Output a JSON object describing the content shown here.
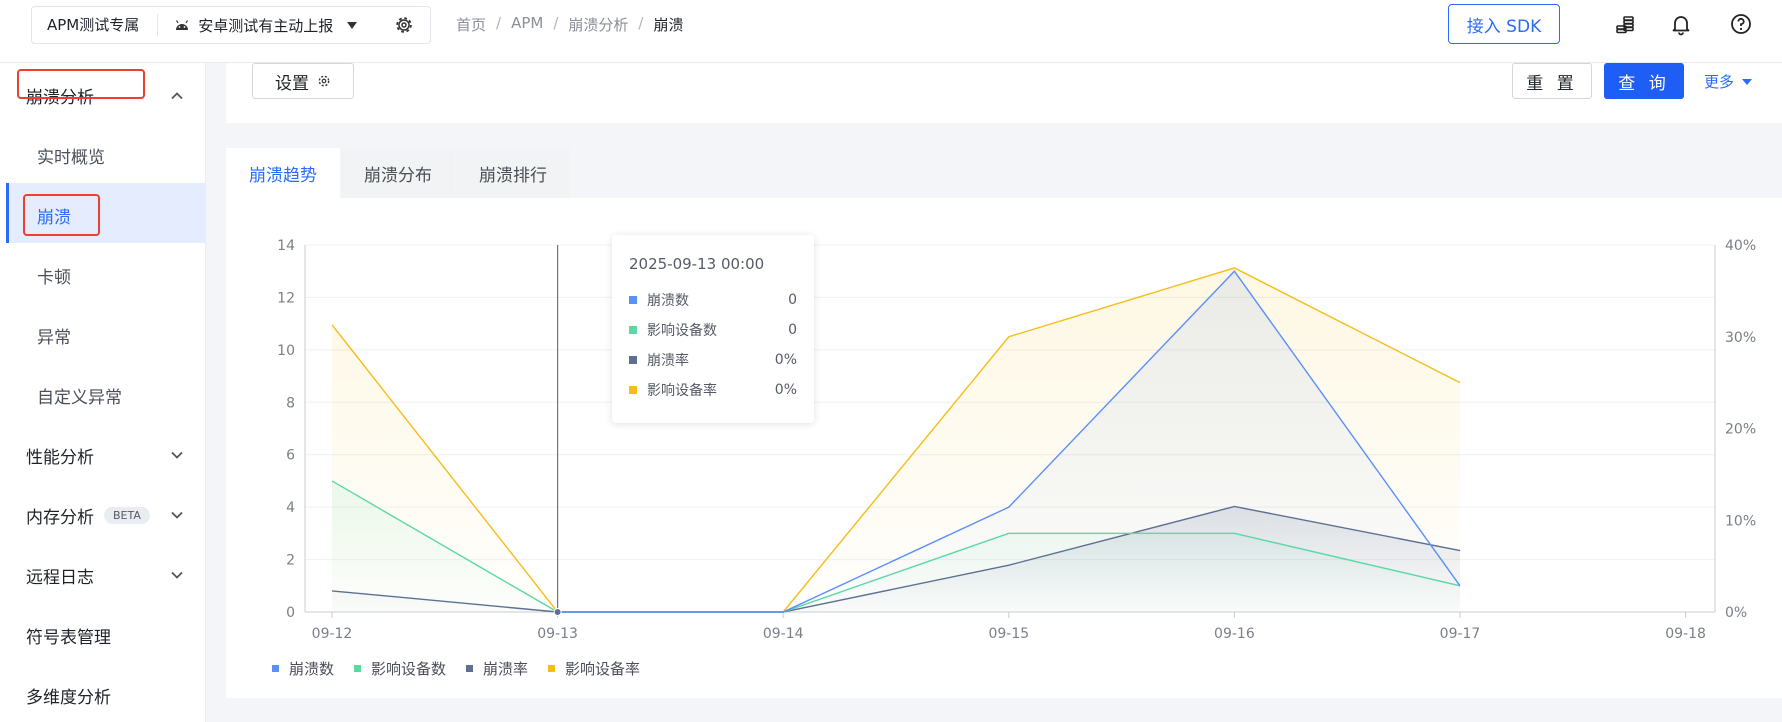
{
  "header": {
    "app_name": "APM测试专属",
    "platform": "安卓测试有主动上报",
    "breadcrumb": [
      "首页",
      "APM",
      "崩溃分析",
      "崩溃"
    ],
    "sdk_button": "接入 SDK"
  },
  "sidebar": {
    "group_crash": "崩溃分析",
    "items": [
      "实时概览",
      "崩溃",
      "卡顿",
      "异常",
      "自定义异常"
    ],
    "group_perf": "性能分析",
    "group_mem": "内存分析",
    "mem_badge": "BETA",
    "group_log": "远程日志",
    "symbol": "符号表管理",
    "multi": "多维度分析"
  },
  "toolbar": {
    "settings": "设置",
    "reset": "重 置",
    "query": "查 询",
    "more": "更多"
  },
  "tabs": [
    "崩溃趋势",
    "崩溃分布",
    "崩溃排行"
  ],
  "tooltip": {
    "title": "2025-09-13 00:00",
    "rows": [
      {
        "label": "崩溃数",
        "value": "0"
      },
      {
        "label": "影响设备数",
        "value": "0"
      },
      {
        "label": "崩溃率",
        "value": "0%"
      },
      {
        "label": "影响设备率",
        "value": "0%"
      }
    ]
  },
  "colors": {
    "crash_count": "#5b8ff9",
    "affected_devices": "#5ad8a6",
    "crash_rate": "#5d7092",
    "affected_rate": "#f6bd16",
    "primary": "#2b6cf6"
  },
  "chart_data": {
    "type": "line",
    "x": [
      "09-12",
      "09-13",
      "09-14",
      "09-15",
      "09-16",
      "09-17",
      "09-18"
    ],
    "y_left_ticks": [
      "0",
      "2",
      "4",
      "6",
      "8",
      "10",
      "12",
      "14"
    ],
    "y_right_ticks": [
      "0%",
      "10%",
      "20%",
      "30%",
      "40%"
    ],
    "ylim_left": [
      0,
      14
    ],
    "ylim_right": [
      0,
      40
    ],
    "series": [
      {
        "name": "崩溃数",
        "axis": "left",
        "values": [
          null,
          0,
          0,
          4,
          13,
          1,
          null
        ]
      },
      {
        "name": "影响设备数",
        "axis": "left",
        "values": [
          5,
          0,
          0,
          3,
          3,
          1,
          null
        ]
      },
      {
        "name": "崩溃率",
        "axis": "right",
        "values": [
          2.3,
          0,
          0,
          5.1,
          11.5,
          6.7,
          null
        ]
      },
      {
        "name": "影响设备率",
        "axis": "right",
        "values": [
          31.3,
          0,
          0,
          30,
          37.5,
          25,
          null
        ]
      }
    ],
    "grid": true,
    "legend": "bottom-left"
  }
}
